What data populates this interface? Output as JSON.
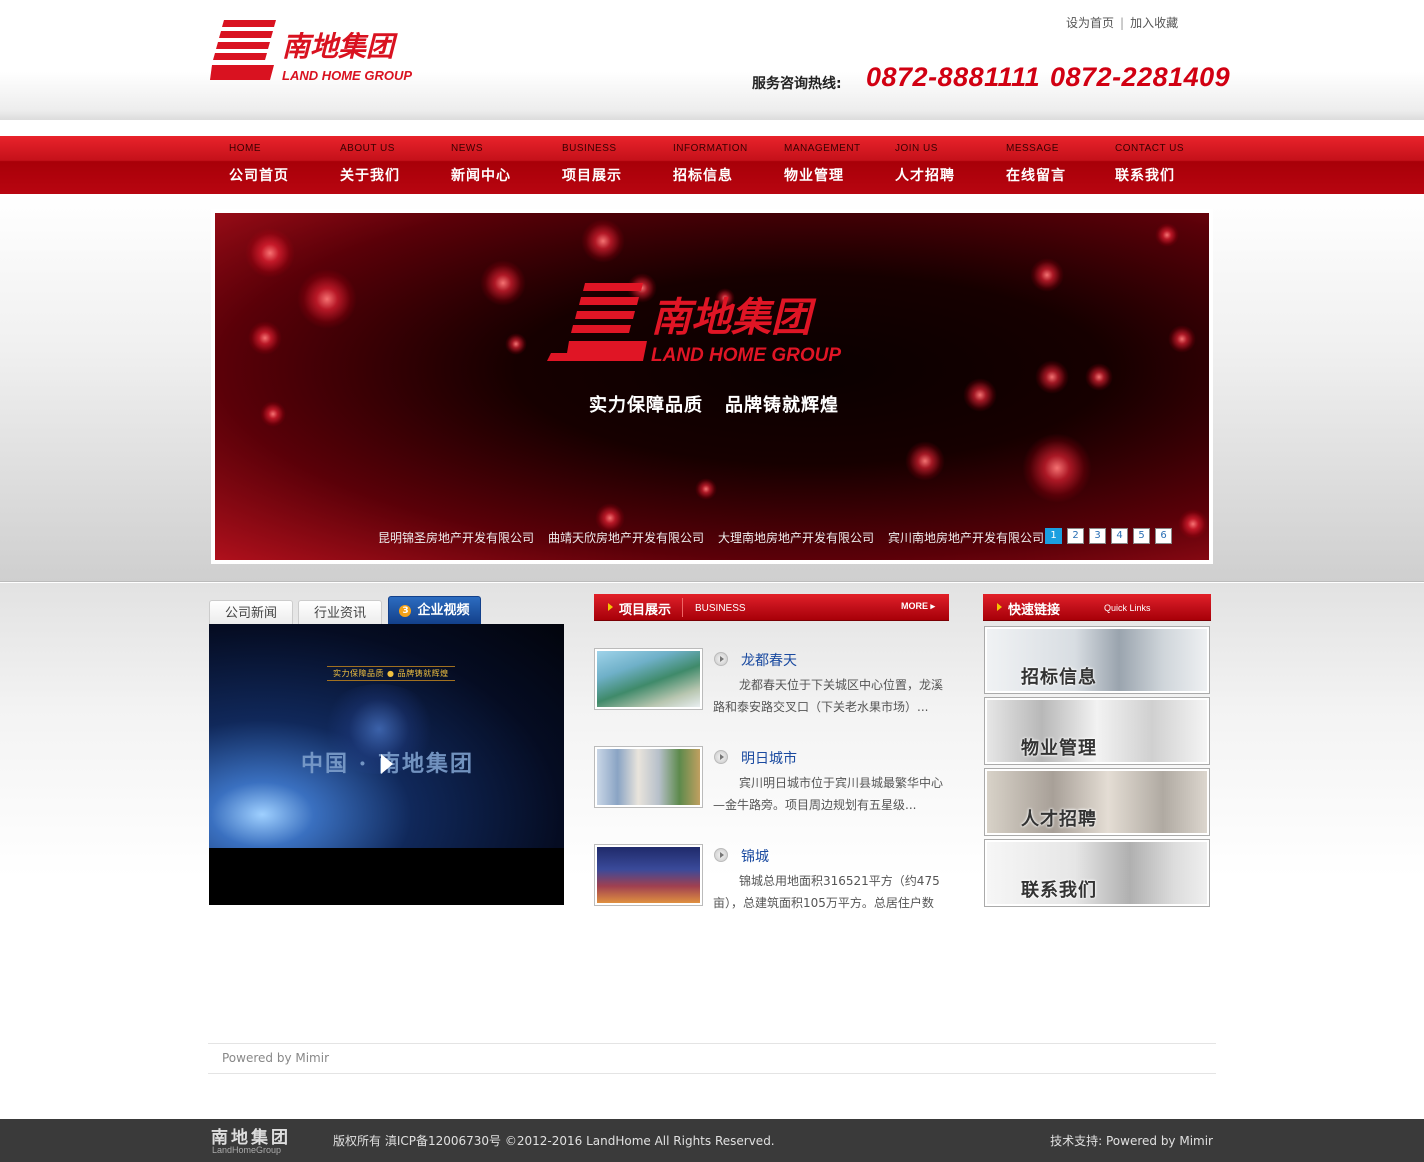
{
  "header": {
    "brand_cn": "南地集团",
    "brand_en": "LAND HOME GROUP",
    "links": [
      "设为首页",
      "加入收藏"
    ],
    "hotline_label": "服务咨询热线:",
    "hotlines": [
      "0872-8881111",
      "0872-2281409"
    ]
  },
  "nav": [
    {
      "en": "HOME",
      "cn": "公司首页"
    },
    {
      "en": "ABOUT US",
      "cn": "关于我们"
    },
    {
      "en": "NEWS",
      "cn": "新闻中心"
    },
    {
      "en": "BUSINESS",
      "cn": "项目展示"
    },
    {
      "en": "INFORMATION",
      "cn": "招标信息"
    },
    {
      "en": "MANAGEMENT",
      "cn": "物业管理"
    },
    {
      "en": "JOIN US",
      "cn": "人才招聘"
    },
    {
      "en": "MESSAGE",
      "cn": "在线留言"
    },
    {
      "en": "CONTACT US",
      "cn": "联系我们"
    }
  ],
  "banner": {
    "brand_cn": "南地集团",
    "brand_en": "LAND HOME GROUP",
    "slogan": [
      "实力保障品质",
      "品牌铸就辉煌"
    ],
    "companies": [
      "昆明锦圣房地产开发有限公司",
      "曲靖天欣房地产开发有限公司",
      "大理南地房地产开发有限公司",
      "宾川南地房地产开发有限公司"
    ],
    "pages": [
      "1",
      "2",
      "3",
      "4",
      "5",
      "6"
    ],
    "active_page": "1"
  },
  "tabs": {
    "items": [
      "公司新闻",
      "行业资讯",
      "企业视频"
    ],
    "active_num": "3",
    "video_caption": "实力保障品质 ● 品牌铸就辉煌",
    "video_title": "中国 · 南地集团"
  },
  "business": {
    "title": "项目展示",
    "sub": "BUSINESS",
    "more": "MORE",
    "projects": [
      {
        "name": "龙都春天",
        "desc": "龙都春天位于下关城区中心位置，龙溪路和泰安路交叉口（下关老水果市场）..."
      },
      {
        "name": "明日城市",
        "desc": "宾川明日城市位于宾川县城最繁华中心—金牛路旁。项目周边规划有五星级..."
      },
      {
        "name": "锦城",
        "desc": "锦城总用地面积316521平方（约475亩），总建筑面积105万平方。总居住户数"
      }
    ]
  },
  "quicklinks": {
    "title": "快速链接",
    "sub": "Quick Links",
    "items": [
      "招标信息",
      "物业管理",
      "人才招聘",
      "联系我们"
    ]
  },
  "footer": {
    "powered": "Powered by Mimir",
    "logo_cn": "南地集团",
    "logo_en": "LandHomeGroup",
    "copyright": "版权所有 滇ICP备12006730号 ©2012-2016 LandHome All Rights Reserved.",
    "support": "技术支持: Powered by Mimir"
  },
  "colors": {
    "brand_red": "#d10012",
    "nav_red": "#c5111a",
    "tab_blue": "#1d56a8"
  }
}
